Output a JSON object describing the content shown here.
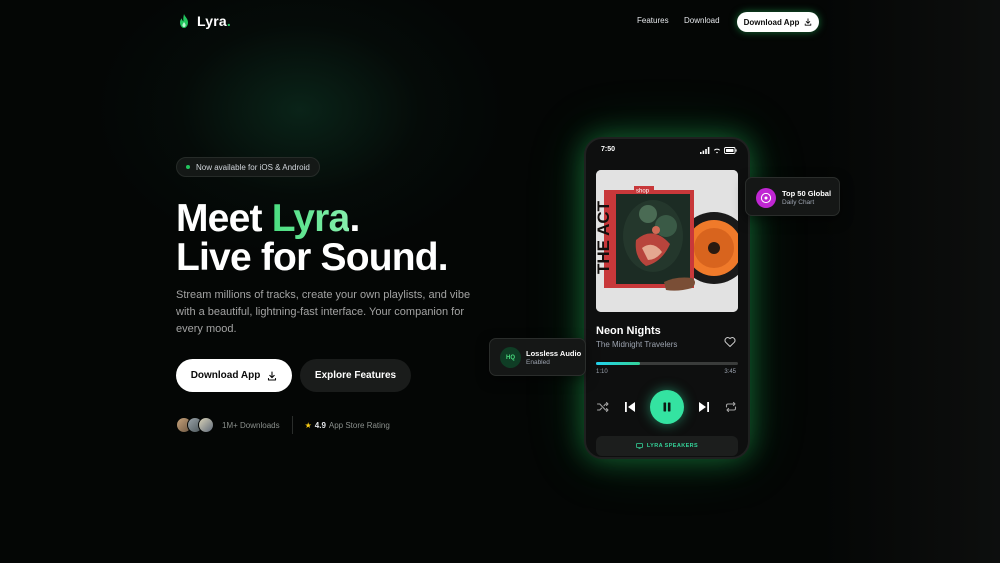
{
  "brand": {
    "name": "Lyra",
    "dot": "."
  },
  "nav": {
    "links": [
      "Features",
      "Download"
    ],
    "cta": "Download App"
  },
  "hero": {
    "badge": "Now available for iOS & Android",
    "heading_line1_prefix": "Meet ",
    "heading_line1_accent": "Lyra",
    "heading_line1_suffix": ".",
    "heading_line2": "Live for Sound.",
    "subtitle": "Stream millions of tracks, create your own playlists, and vibe with a beautiful, lightning-fast interface. Your companion for every mood.",
    "primary_button": "Download App",
    "secondary_button": "Explore Features",
    "downloads": "1M+ Downloads",
    "rating_value": "4.9",
    "rating_label": "App Store Rating"
  },
  "phone": {
    "time": "7:50",
    "track_title": "Neon Nights",
    "track_artist": "The Midnight Travelers",
    "current_time": "1:10",
    "total_time": "3:45",
    "progress_fraction": 0.31,
    "device_label": "LYRA SPEAKERS",
    "album_text": "THE ACT",
    "album_sticker": "shop"
  },
  "cards": {
    "top": {
      "title": "Top 50 Global",
      "subtitle": "Daily Chart"
    },
    "left": {
      "badge": "HQ",
      "title": "Lossless Audio",
      "subtitle": "Enabled"
    }
  },
  "colors": {
    "accent": "#22c55e",
    "play": "#34e3a1",
    "progress_start": "#22d3ee",
    "chart_icon": "#c026d3"
  },
  "icons": [
    "flame-icon",
    "download-icon",
    "heart-icon",
    "shuffle-icon",
    "previous-icon",
    "pause-icon",
    "next-icon",
    "repeat-icon",
    "speaker-icon",
    "disc-icon",
    "signal-icon",
    "wifi-icon",
    "battery-icon"
  ]
}
